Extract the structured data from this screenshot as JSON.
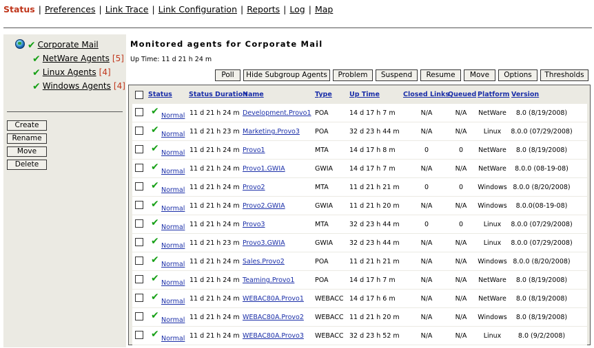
{
  "nav": {
    "items": [
      {
        "label": "Status",
        "active": true
      },
      {
        "label": "Preferences",
        "active": false
      },
      {
        "label": "Link Trace",
        "active": false
      },
      {
        "label": "Link Configuration",
        "active": false
      },
      {
        "label": "Reports",
        "active": false
      },
      {
        "label": "Log",
        "active": false
      },
      {
        "label": "Map",
        "active": false
      }
    ],
    "separator": "|"
  },
  "tree": {
    "root": {
      "label": "Corporate Mail"
    },
    "children": [
      {
        "label": "NetWare Agents",
        "count": "[5]"
      },
      {
        "label": "Linux Agents",
        "count": "[4]"
      },
      {
        "label": "Windows Agents",
        "count": "[4]"
      }
    ]
  },
  "left_actions": [
    "Create",
    "Rename",
    "Move",
    "Delete"
  ],
  "main": {
    "title": "Monitored agents for Corporate Mail",
    "uptime": "Up Time: 11 d 21 h 24 m"
  },
  "action_buttons": [
    "Poll",
    "Hide Subgroup Agents",
    "Problem",
    "Suspend",
    "Resume",
    "Move",
    "Options",
    "Thresholds"
  ],
  "table": {
    "columns": [
      "Status",
      "Status Duration",
      "Name",
      "Type",
      "Up Time",
      "Closed Links",
      "Queued",
      "Platform",
      "Version"
    ],
    "rows": [
      {
        "status": "Normal",
        "duration": "11 d 21 h 24 m",
        "name": "Development.Provo1",
        "type": "POA",
        "uptime": "14 d 17 h 7 m",
        "closed": "N/A",
        "queued": "N/A",
        "platform": "NetWare",
        "version": "8.0 (8/19/2008)"
      },
      {
        "status": "Normal",
        "duration": "11 d 21 h 23 m",
        "name": "Marketing.Provo3",
        "type": "POA",
        "uptime": "32 d 23 h 44 m",
        "closed": "N/A",
        "queued": "N/A",
        "platform": "Linux",
        "version": "8.0.0 (07/29/2008)"
      },
      {
        "status": "Normal",
        "duration": "11 d 21 h 24 m",
        "name": "Provo1",
        "type": "MTA",
        "uptime": "14 d 17 h 8 m",
        "closed": "0",
        "queued": "0",
        "platform": "NetWare",
        "version": "8.0 (8/19/2008)"
      },
      {
        "status": "Normal",
        "duration": "11 d 21 h 24 m",
        "name": "Provo1.GWIA",
        "type": "GWIA",
        "uptime": "14 d 17 h 7 m",
        "closed": "N/A",
        "queued": "N/A",
        "platform": "NetWare",
        "version": "8.0.0 (08-19-08)"
      },
      {
        "status": "Normal",
        "duration": "11 d 21 h 24 m",
        "name": "Provo2",
        "type": "MTA",
        "uptime": "11 d 21 h 21 m",
        "closed": "0",
        "queued": "0",
        "platform": "Windows",
        "version": "8.0.0 (8/20/2008)"
      },
      {
        "status": "Normal",
        "duration": "11 d 21 h 24 m",
        "name": "Provo2.GWIA",
        "type": "GWIA",
        "uptime": "11 d 21 h 20 m",
        "closed": "N/A",
        "queued": "N/A",
        "platform": "Windows",
        "version": "8.0.0(08-19-08)"
      },
      {
        "status": "Normal",
        "duration": "11 d 21 h 24 m",
        "name": "Provo3",
        "type": "MTA",
        "uptime": "32 d 23 h 44 m",
        "closed": "0",
        "queued": "0",
        "platform": "Linux",
        "version": "8.0.0 (07/29/2008)"
      },
      {
        "status": "Normal",
        "duration": "11 d 21 h 23 m",
        "name": "Provo3.GWIA",
        "type": "GWIA",
        "uptime": "32 d 23 h 44 m",
        "closed": "N/A",
        "queued": "N/A",
        "platform": "Linux",
        "version": "8.0.0 (07/29/2008)"
      },
      {
        "status": "Normal",
        "duration": "11 d 21 h 24 m",
        "name": "Sales.Provo2",
        "type": "POA",
        "uptime": "11 d 21 h 21 m",
        "closed": "N/A",
        "queued": "N/A",
        "platform": "Windows",
        "version": "8.0.0 (8/20/2008)"
      },
      {
        "status": "Normal",
        "duration": "11 d 21 h 24 m",
        "name": "Teaming.Provo1",
        "type": "POA",
        "uptime": "14 d 17 h 7 m",
        "closed": "N/A",
        "queued": "N/A",
        "platform": "NetWare",
        "version": "8.0 (8/19/2008)"
      },
      {
        "status": "Normal",
        "duration": "11 d 21 h 24 m",
        "name": "WEBAC80A.Provo1",
        "type": "WEBACC",
        "uptime": "14 d 17 h 6 m",
        "closed": "N/A",
        "queued": "N/A",
        "platform": "NetWare",
        "version": "8.0 (8/19/2008)"
      },
      {
        "status": "Normal",
        "duration": "11 d 21 h 24 m",
        "name": "WEBAC80A.Provo2",
        "type": "WEBACC",
        "uptime": "11 d 21 h 20 m",
        "closed": "N/A",
        "queued": "N/A",
        "platform": "Windows",
        "version": "8.0 (8/19/2008)"
      },
      {
        "status": "Normal",
        "duration": "11 d 21 h 24 m",
        "name": "WEBAC80A.Provo3",
        "type": "WEBACC",
        "uptime": "32 d 23 h 52 m",
        "closed": "N/A",
        "queued": "N/A",
        "platform": "Linux",
        "version": "8.0 (9/2/2008)"
      }
    ]
  },
  "icons": {
    "check": "check-icon",
    "globe": "globe-icon"
  },
  "colors": {
    "accent_red": "#c0361b",
    "link_blue": "#1a2ea8",
    "check_green": "#16a016",
    "panel_bg": "#ebeae3"
  }
}
